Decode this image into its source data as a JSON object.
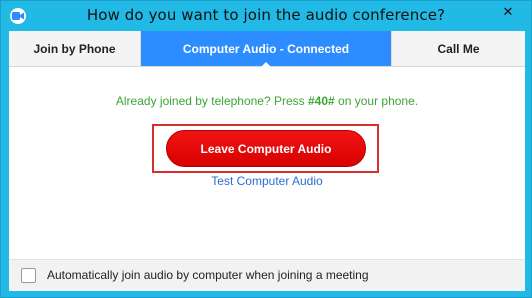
{
  "window": {
    "title": "How do you want to join the audio conference?",
    "close_glyph": "✕",
    "app_icon": "zoom-camera-icon"
  },
  "tabs": [
    {
      "label": "Join by Phone",
      "active": false
    },
    {
      "label": "Computer Audio - Connected",
      "active": true
    },
    {
      "label": "Call Me",
      "active": false
    }
  ],
  "message": {
    "prefix": "Already joined by telephone? Press ",
    "code": "#40#",
    "suffix": " on your phone."
  },
  "leave_button": {
    "label": "Leave Computer Audio"
  },
  "test_link": {
    "label": "Test Computer Audio"
  },
  "footer": {
    "checkbox_checked": false,
    "checkbox_label": "Automatically join audio by computer when joining a meeting"
  },
  "colors": {
    "window_frame": "#21b9e6",
    "active_tab": "#2d8cff",
    "message_text": "#3da633",
    "leave_button": "#e00000",
    "highlight_border": "#d6302c",
    "link": "#2b6ed3"
  }
}
